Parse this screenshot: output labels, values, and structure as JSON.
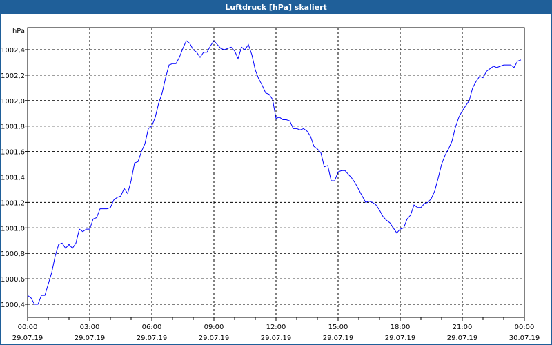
{
  "window": {
    "title": "Luftdruck [hPa] skaliert"
  },
  "chart_data": {
    "type": "line",
    "title": "Luftdruck [hPa] skaliert",
    "ylabel": "hPa",
    "xlabel": "",
    "ylim": [
      1000.3,
      1002.53
    ],
    "yticks": [
      1000.4,
      1000.6,
      1000.8,
      1001.0,
      1001.2,
      1001.4,
      1001.6,
      1001.8,
      1002.0,
      1002.2,
      1002.4
    ],
    "ytick_labels": [
      "1000,4",
      "1000,6",
      "1000,8",
      "1001,0",
      "1001,2",
      "1001,4",
      "1001,6",
      "1001,8",
      "1002,0",
      "1002,2",
      "1002,4"
    ],
    "xtick_labels": [
      {
        "time": "00:00",
        "date": "29.07.19"
      },
      {
        "time": "03:00",
        "date": "29.07.19"
      },
      {
        "time": "06:00",
        "date": "29.07.19"
      },
      {
        "time": "09:00",
        "date": "29.07.19"
      },
      {
        "time": "12:00",
        "date": "29.07.19"
      },
      {
        "time": "15:00",
        "date": "29.07.19"
      },
      {
        "time": "18:00",
        "date": "29.07.19"
      },
      {
        "time": "21:00",
        "date": "29.07.19"
      },
      {
        "time": "00:00",
        "date": "30.07.19"
      }
    ],
    "xlim": [
      "29.07.19 00:00",
      "30.07.19 00:00"
    ],
    "grid": true,
    "line_color": "#0000ff",
    "series": [
      {
        "x": [
          "00:00",
          "00:10",
          "00:20",
          "00:30",
          "00:40",
          "00:50",
          "01:00",
          "01:10",
          "01:20",
          "01:30",
          "01:40",
          "01:50",
          "02:00",
          "02:10",
          "02:20",
          "02:30",
          "02:40",
          "02:50",
          "03:00",
          "03:10",
          "03:20",
          "03:30",
          "03:40",
          "03:50",
          "04:00",
          "04:10",
          "04:20",
          "04:30",
          "04:40",
          "04:50",
          "05:00",
          "05:10",
          "05:20",
          "05:30",
          "05:40",
          "05:50",
          "06:00",
          "06:10",
          "06:20",
          "06:30",
          "06:40",
          "06:50",
          "07:00",
          "07:10",
          "07:20",
          "07:30",
          "07:40",
          "07:50",
          "08:00",
          "08:10",
          "08:20",
          "08:30",
          "08:40",
          "08:50",
          "09:00",
          "09:10",
          "09:20",
          "09:30",
          "09:40",
          "09:50",
          "10:00",
          "10:10",
          "10:20",
          "10:30",
          "10:40",
          "10:50",
          "11:00",
          "11:10",
          "11:20",
          "11:30",
          "11:40",
          "11:50",
          "12:00",
          "12:10",
          "12:20",
          "12:30",
          "12:40",
          "12:50",
          "13:00",
          "13:10",
          "13:20",
          "13:30",
          "13:40",
          "13:50",
          "14:00",
          "14:10",
          "14:20",
          "14:30",
          "14:40",
          "14:50",
          "15:00",
          "15:10",
          "15:20",
          "15:30",
          "15:40",
          "15:50",
          "16:00",
          "16:10",
          "16:20",
          "16:30",
          "16:40",
          "16:50",
          "17:00",
          "17:10",
          "17:20",
          "17:30",
          "17:40",
          "17:50",
          "18:00",
          "18:10",
          "18:20",
          "18:30",
          "18:40",
          "18:50",
          "19:00",
          "19:10",
          "19:20",
          "19:30",
          "19:40",
          "19:50",
          "20:00",
          "20:10",
          "20:20",
          "20:30",
          "20:40",
          "20:50",
          "21:00",
          "21:10",
          "21:20",
          "21:30",
          "21:40",
          "21:50",
          "22:00",
          "22:10",
          "22:20",
          "22:30",
          "22:40",
          "22:50",
          "23:00",
          "23:10",
          "23:20",
          "23:30",
          "23:40",
          "23:50"
        ],
        "y": [
          1000.47,
          1000.45,
          1000.4,
          1000.4,
          1000.47,
          1000.47,
          1000.56,
          1000.65,
          1000.78,
          1000.87,
          1000.88,
          1000.84,
          1000.87,
          1000.84,
          1000.88,
          1000.99,
          1000.97,
          1000.99,
          1000.99,
          1001.07,
          1001.08,
          1001.15,
          1001.15,
          1001.15,
          1001.16,
          1001.22,
          1001.24,
          1001.25,
          1001.31,
          1001.27,
          1001.37,
          1001.51,
          1001.52,
          1001.6,
          1001.66,
          1001.78,
          1001.8,
          1001.87,
          1001.98,
          1002.06,
          1002.18,
          1002.28,
          1002.29,
          1002.29,
          1002.34,
          1002.41,
          1002.47,
          1002.45,
          1002.4,
          1002.38,
          1002.34,
          1002.38,
          1002.38,
          1002.43,
          1002.47,
          1002.44,
          1002.41,
          1002.4,
          1002.41,
          1002.42,
          1002.39,
          1002.33,
          1002.42,
          1002.4,
          1002.44,
          1002.36,
          1002.24,
          1002.17,
          1002.12,
          1002.06,
          1002.05,
          1002.01,
          1001.86,
          1001.87,
          1001.85,
          1001.85,
          1001.84,
          1001.78,
          1001.78,
          1001.77,
          1001.78,
          1001.76,
          1001.72,
          1001.64,
          1001.62,
          1001.59,
          1001.48,
          1001.49,
          1001.37,
          1001.37,
          1001.44,
          1001.45,
          1001.45,
          1001.42,
          1001.39,
          1001.35,
          1001.3,
          1001.25,
          1001.2,
          1001.21,
          1001.2,
          1001.18,
          1001.14,
          1001.09,
          1001.06,
          1001.04,
          1001.0,
          1000.96,
          1000.99,
          1001.0,
          1001.07,
          1001.1,
          1001.18,
          1001.16,
          1001.16,
          1001.19,
          1001.2,
          1001.23,
          1001.29,
          1001.39,
          1001.5,
          1001.57,
          1001.62,
          1001.68,
          1001.79,
          1001.87,
          1001.92,
          1001.96,
          1002.0,
          1002.1,
          1002.15,
          1002.19,
          1002.18,
          1002.23,
          1002.25,
          1002.27,
          1002.26,
          1002.27,
          1002.28,
          1002.28,
          1002.28,
          1002.26,
          1002.31,
          1002.32
        ]
      }
    ]
  }
}
